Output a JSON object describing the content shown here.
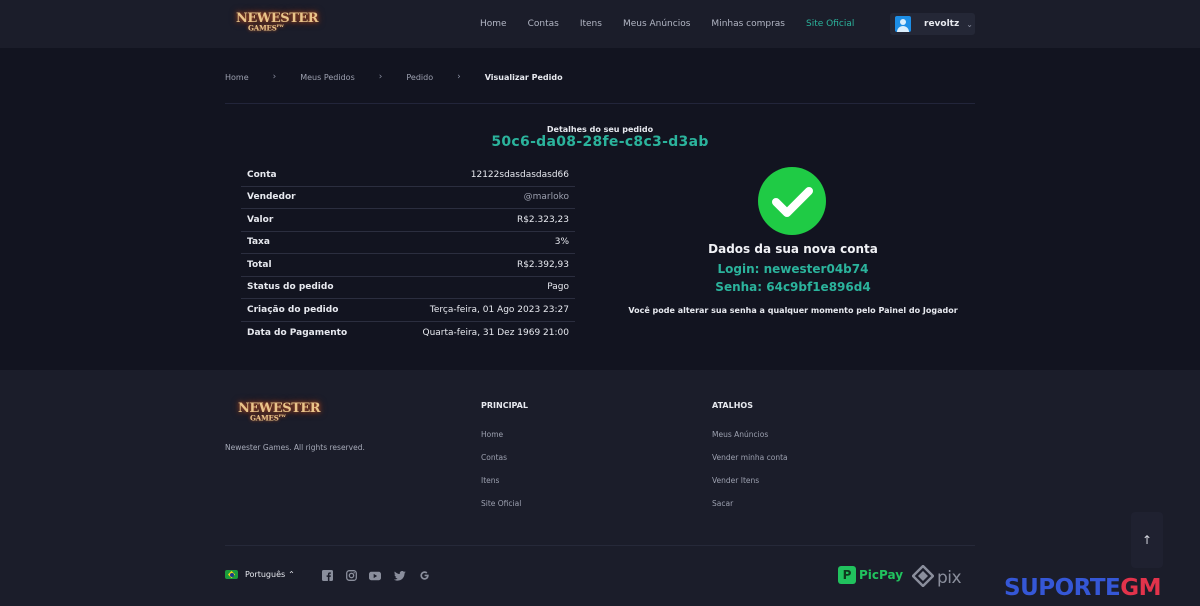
{
  "header": {
    "logo": {
      "top": "NEWESTER",
      "bottom": "GAMES",
      "sup": "PW"
    },
    "nav": [
      {
        "label": "Home",
        "active": false
      },
      {
        "label": "Contas",
        "active": false
      },
      {
        "label": "Itens",
        "active": false
      },
      {
        "label": "Meus Anúncios",
        "active": false
      },
      {
        "label": "Minhas compras",
        "active": false
      },
      {
        "label": "Site Oficial",
        "active": true
      }
    ],
    "user": {
      "name": "revoltz"
    }
  },
  "breadcrumb": [
    "Home",
    "Meus Pedidos",
    "Pedido",
    "Visualizar Pedido"
  ],
  "order": {
    "details_label": "Detalhes do seu pedido",
    "id": "50c6-da08-28fe-c8c3-d3ab",
    "rows": [
      {
        "label": "Conta",
        "value": "12122sdasdasdasd66"
      },
      {
        "label": "Vendedor",
        "value": "@marloko"
      },
      {
        "label": "Valor",
        "value": "R$2.323,23"
      },
      {
        "label": "Taxa",
        "value": "3%"
      },
      {
        "label": "Total",
        "value": "R$2.392,93"
      },
      {
        "label": "Status do pedido",
        "value": "Pago"
      },
      {
        "label": "Criação do pedido",
        "value": "Terça-feira, 01 Ago 2023 23:27"
      },
      {
        "label": "Data do Pagamento",
        "value": "Quarta-feira, 31 Dez 1969 21:00"
      }
    ]
  },
  "account": {
    "title": "Dados da sua nova conta",
    "login": "Login: newester04b74",
    "password": "Senha: 64c9bf1e896d4",
    "note": "Você pode alterar sua senha a qualquer momento pelo Painel do Jogador"
  },
  "footer": {
    "logo": {
      "top": "NEWESTER",
      "bottom": "GAMES",
      "sup": "PW"
    },
    "rights": "Newester Games. All rights reserved.",
    "principal_title": "PRINCIPAL",
    "principal_links": [
      "Home",
      "Contas",
      "Itens",
      "Site Oficial"
    ],
    "atalhos_title": "ATALHOS",
    "atalhos_links": [
      "Meus Anúncios",
      "Vender minha conta",
      "Vender Itens",
      "Sacar"
    ],
    "language": "Português",
    "social_icons": [
      "facebook-icon",
      "instagram-icon",
      "youtube-icon",
      "twitter-icon",
      "google-icon"
    ],
    "payments": {
      "picpay": "PicPay",
      "pix": "pix"
    }
  },
  "scroll_top": {
    "icon": "arrow-up-icon"
  },
  "watermark": {
    "part1": "SUPORTE",
    "part2": "GM"
  },
  "colors": {
    "accent": "#2bb39c",
    "success": "#1fcb45",
    "background": "#121420",
    "panel": "#1b1d2a"
  }
}
